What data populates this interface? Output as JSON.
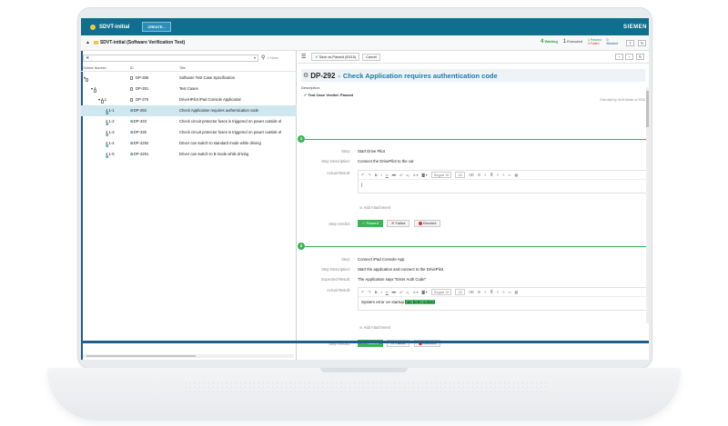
{
  "app": {
    "project": "SDVT-initial",
    "create_label": "CREATE...",
    "brand": "SIEMEN"
  },
  "titlebar": {
    "title": "SDVT-initial (Software Verification Test)",
    "waiting_count": "4",
    "waiting_label": "Waiting",
    "executed_count": "1",
    "executed_label": "Executed",
    "passed": "1 Passed",
    "failed": "0 Failed",
    "blocked_count": "0",
    "blocked_label": "Blocked"
  },
  "left": {
    "filter_star": "★",
    "filter_none": "0 None",
    "columns": [
      "Outline Number",
      "ID",
      "Title"
    ],
    "rows": [
      {
        "outline": "",
        "id": "DP-286",
        "title": "Software Test Case Specification",
        "indent": 0,
        "type": "folder"
      },
      {
        "outline": "4",
        "id": "DP-291",
        "title": "Test Cases",
        "indent": 1,
        "type": "folder"
      },
      {
        "outline": "4.1",
        "id": "DP-275",
        "title": "DriveHPilot iPad Console Application",
        "indent": 2,
        "type": "folder"
      },
      {
        "outline": "4.1-1",
        "id": "DP-292",
        "title": "Check Application requires authentication code",
        "indent": 3,
        "type": "tc",
        "selected": true
      },
      {
        "outline": "4.1-2",
        "id": "DP-333",
        "title": "Check circuit protector fuses is triggered on power outside of",
        "indent": 3,
        "type": "tc"
      },
      {
        "outline": "4.1-3",
        "id": "DP-335",
        "title": "Check circuit protector fuses is triggered on power outside of",
        "indent": 3,
        "type": "tc"
      },
      {
        "outline": "4.1-4",
        "id": "DP-2292",
        "title": "Driver can switch to standard mode while driving",
        "indent": 3,
        "type": "tc"
      },
      {
        "outline": "4.1-5",
        "id": "DP-2291",
        "title": "Driver can switch to B mode while driving",
        "indent": 3,
        "type": "tc"
      }
    ]
  },
  "right": {
    "save_label": "Save as Passed (83/15)",
    "cancel_label": "Cancel",
    "doc_id": "DP-292",
    "doc_sep": "-",
    "doc_title": "Check Application requires authentication code",
    "description_label": "Description:",
    "verdict_label": "Test Case Verdict: Passed",
    "executed_by": "Executed by: ALM Admin on 2024",
    "labels": {
      "step": "Step:",
      "step_description": "Step Description:",
      "expected_result": "Expected Result:",
      "actual_result": "Actual Result:",
      "add_attachment": "Add Attachment",
      "step_verdict": "Step Verdict:",
      "passed": "Passed",
      "failed": "Failed",
      "blocked": "Blocked"
    },
    "editor": {
      "font": "Segoe UI",
      "size": "10"
    },
    "steps": [
      {
        "num": "1",
        "step": "Start Drive Pilot",
        "description": "Connect the DrivePilot to the car",
        "actual_text": "",
        "actual_highlight": ""
      },
      {
        "num": "2",
        "step": "Connect iPad Console App",
        "description": "Start the application and connect to the DrivePilot",
        "expected": "The Application says \"Enter Auth Code\"",
        "actual_text": "System error on startup ",
        "actual_highlight": "has been solved"
      },
      {
        "num": "3"
      }
    ]
  },
  "colors": {
    "topbar": "#0f6f8f",
    "step_green": "#3cb455",
    "selection": "#cfe7ef",
    "title_blue": "#1f7aa8"
  }
}
